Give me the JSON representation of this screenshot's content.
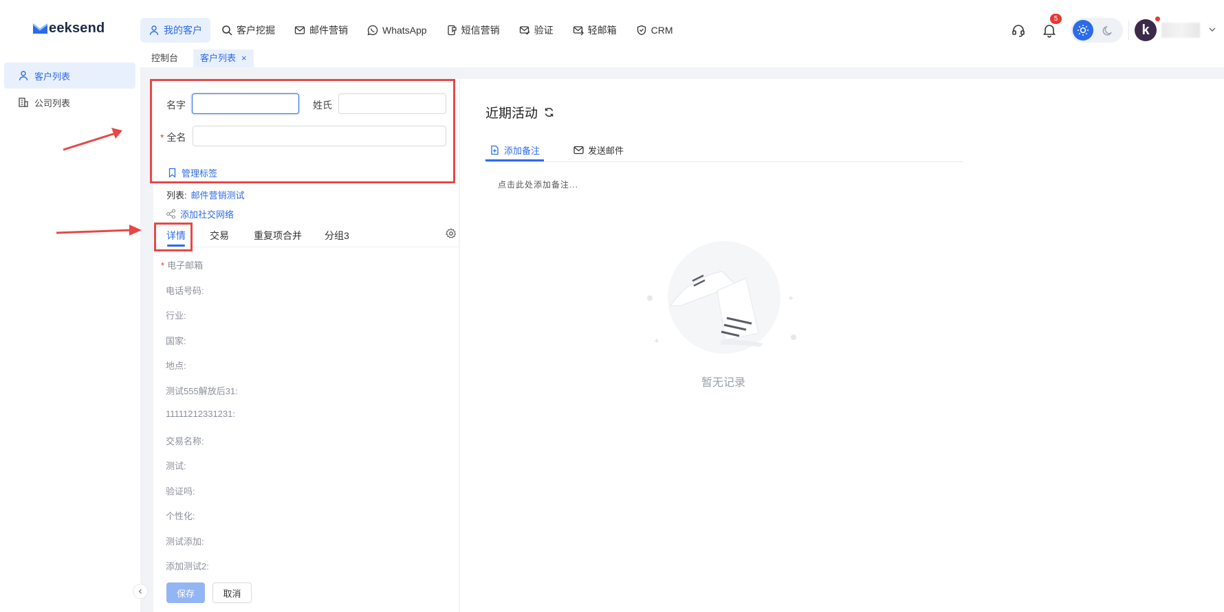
{
  "app": {
    "logo_text": "eeksend",
    "brand_color": "#2c6bea"
  },
  "nav": {
    "items": [
      {
        "label": "我的客户",
        "icon": "user-icon",
        "active": true
      },
      {
        "label": "客户挖掘",
        "icon": "search-icon",
        "active": false
      },
      {
        "label": "邮件营销",
        "icon": "mail-icon",
        "active": false
      },
      {
        "label": "WhatsApp",
        "icon": "whatsapp-icon",
        "active": false
      },
      {
        "label": "短信营销",
        "icon": "sms-icon",
        "active": false
      },
      {
        "label": "验证",
        "icon": "mail-check-icon",
        "active": false
      },
      {
        "label": "轻邮箱",
        "icon": "light-mail-icon",
        "active": false
      },
      {
        "label": "CRM",
        "icon": "shield-icon",
        "active": false
      }
    ]
  },
  "header": {
    "notification_count": "5",
    "avatar_letter": "k"
  },
  "page_tabs": [
    {
      "label": "控制台",
      "active": false
    },
    {
      "label": "客户列表",
      "active": true,
      "close": "×"
    }
  ],
  "sidebar": {
    "items": [
      {
        "label": "客户列表",
        "icon": "user-icon",
        "active": true
      },
      {
        "label": "公司列表",
        "icon": "building-icon",
        "active": false
      }
    ]
  },
  "form": {
    "first_name_label": "名字",
    "first_name_value": "",
    "last_name_label": "姓氏",
    "last_name_value": "",
    "full_name_required": "*",
    "full_name_label": "全名",
    "full_name_value": "",
    "manage_tags": "管理标签",
    "list_prefix": "列表: ",
    "list_value": "邮件营销测试",
    "add_social": "添加社交网络"
  },
  "detail_tabs": [
    {
      "label": "详情",
      "active": true
    },
    {
      "label": "交易",
      "active": false
    },
    {
      "label": "重复项合并",
      "active": false
    },
    {
      "label": "分组3",
      "active": false
    }
  ],
  "detail_fields": [
    {
      "label": "电子邮箱",
      "required": "*"
    },
    {
      "label": "电话号码:"
    },
    {
      "label": "行业:"
    },
    {
      "label": "国家:"
    },
    {
      "label": "地点:"
    },
    {
      "label": "测试555解放后31:"
    },
    {
      "label": "11111212331231:"
    },
    {
      "label": "交易名称:"
    },
    {
      "label": "测试:"
    },
    {
      "label": "验证吗:"
    },
    {
      "label": "个性化:"
    },
    {
      "label": "测试添加:"
    },
    {
      "label": "添加测试2:"
    }
  ],
  "buttons": {
    "save": "保存",
    "cancel": "取消"
  },
  "activity": {
    "title": "近期活动",
    "tabs": [
      {
        "label": "添加备注",
        "icon": "note-icon",
        "active": true
      },
      {
        "label": "发送邮件",
        "icon": "mail-icon",
        "active": false
      }
    ],
    "note_placeholder": "点击此处添加备注...",
    "empty_text": "暂无记录"
  },
  "annotation_color": "#e84747"
}
